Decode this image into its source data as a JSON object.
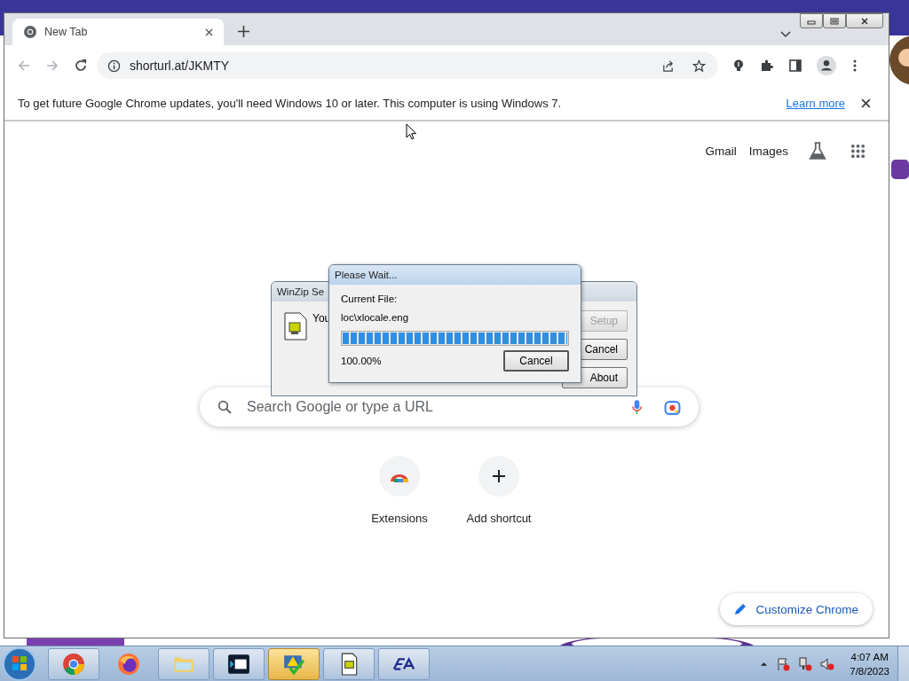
{
  "browser": {
    "tabs": [
      {
        "title": "New Tab",
        "selected": true
      }
    ],
    "address": "shorturl.at/JKMTY",
    "infobar": {
      "message": "To get future Google Chrome updates, you'll need Windows 10 or later. This computer is using Windows 7.",
      "link": "Learn more"
    },
    "header_links": [
      "Gmail",
      "Images"
    ],
    "search": {
      "placeholder": "Search Google or type a URL"
    },
    "shortcuts": [
      {
        "label": "Extensions",
        "kind": "extension"
      },
      {
        "label": "Add shortcut",
        "kind": "add"
      }
    ],
    "customize": "Customize Chrome"
  },
  "winzip": {
    "title": "WinZip Se",
    "message": "You",
    "buttons": [
      {
        "label": "Setup",
        "disabled": true
      },
      {
        "label": "Cancel",
        "disabled": false
      },
      {
        "label": "About",
        "disabled": false
      }
    ]
  },
  "progress": {
    "title": "Please Wait...",
    "file_label": "Current File:",
    "file": "loc\\xlocale.eng",
    "level": 1,
    "percent": "100.00%",
    "button": "Cancel"
  },
  "taskbar": {
    "time": "4:07 AM",
    "date": "7/8/2023"
  }
}
